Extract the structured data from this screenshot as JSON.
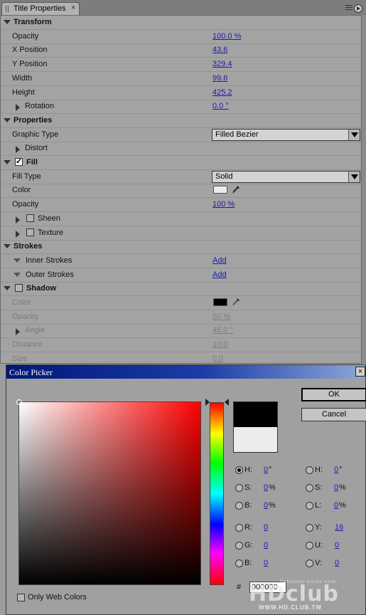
{
  "panel": {
    "tab_label": "Title Properties",
    "tab_close": "×"
  },
  "rows": [
    {
      "type": "section",
      "label": "Transform",
      "expanded": true
    },
    {
      "type": "prop",
      "label": "Opacity",
      "value": "100.0",
      "unit": " %"
    },
    {
      "type": "prop",
      "label": "X Position",
      "value": "43.6"
    },
    {
      "type": "prop",
      "label": "Y Position",
      "value": "329.4"
    },
    {
      "type": "prop",
      "label": "Width",
      "value": "99.6"
    },
    {
      "type": "prop",
      "label": "Height",
      "value": "425.2"
    },
    {
      "type": "subsection",
      "label": "Rotation",
      "value": "0.0",
      "unit": " °"
    },
    {
      "type": "section",
      "label": "Properties",
      "expanded": true
    },
    {
      "type": "dropdown",
      "label": "Graphic Type",
      "value": "Filled Bezier"
    },
    {
      "type": "subsection",
      "label": "Distort"
    },
    {
      "type": "section-check",
      "label": "Fill",
      "checked": true
    },
    {
      "type": "dropdown",
      "label": "Fill Type",
      "value": "Solid"
    },
    {
      "type": "color",
      "label": "Color",
      "color": "#ececec"
    },
    {
      "type": "prop",
      "label": "Opacity",
      "value": "100",
      "unit": " %"
    },
    {
      "type": "sub-check",
      "label": "Sheen",
      "checked": false
    },
    {
      "type": "sub-check",
      "label": "Texture",
      "checked": false
    },
    {
      "type": "section",
      "label": "Strokes",
      "expanded": true
    },
    {
      "type": "stroke",
      "label": "Inner Strokes",
      "value": "Add"
    },
    {
      "type": "stroke",
      "label": "Outer Strokes",
      "value": "Add"
    },
    {
      "type": "section-check",
      "label": "Shadow",
      "checked": false
    },
    {
      "type": "color",
      "label": "Color",
      "color": "#000000",
      "disabled": true
    },
    {
      "type": "prop",
      "label": "Opacity",
      "value": "50",
      "unit": " %",
      "disabled": true
    },
    {
      "type": "subsection",
      "label": "Angle",
      "value": "45.0",
      "unit": " °",
      "disabled": true
    },
    {
      "type": "prop",
      "label": "Distance",
      "value": "10.0",
      "disabled": true
    },
    {
      "type": "prop",
      "label": "Size",
      "value": "0.0",
      "disabled": true
    }
  ],
  "picker": {
    "title": "Color Picker",
    "close": "×",
    "ok": "OK",
    "cancel": "Cancel",
    "new_color": "#000000",
    "old_color": "#ececec",
    "hsb_h_label": "H:",
    "hsb_h_value": "0",
    "hsb_h_unit": "°",
    "hsb_s_label": "S:",
    "hsb_s_value": "0",
    "hsb_s_unit": "%",
    "hsb_b_label": "B:",
    "hsb_b_value": "0",
    "hsb_b_unit": "%",
    "hsl_h_label": "H:",
    "hsl_h_value": "0",
    "hsl_h_unit": "°",
    "hsl_s_label": "S:",
    "hsl_s_value": "0",
    "hsl_s_unit": "%",
    "hsl_l_label": "L:",
    "hsl_l_value": "0",
    "hsl_l_unit": "%",
    "rgb_r_label": "R:",
    "rgb_r_value": "0",
    "rgb_g_label": "G:",
    "rgb_g_value": "0",
    "rgb_b_label": "B:",
    "rgb_b_value": "0",
    "yuv_y_label": "Y:",
    "yuv_y_value": "16",
    "yuv_u_label": "U:",
    "yuv_u_value": "0",
    "yuv_v_label": "V:",
    "yuv_v_value": "0",
    "hex_label": "#",
    "hex_value": "000000",
    "web_colors_label": "Only Web Colors",
    "selected_mode": "hsb_h"
  },
  "watermark": {
    "logo": "HDclub",
    "tagline": "Definition Vision Club",
    "url": "WWW.HD.CLUB.TW"
  }
}
